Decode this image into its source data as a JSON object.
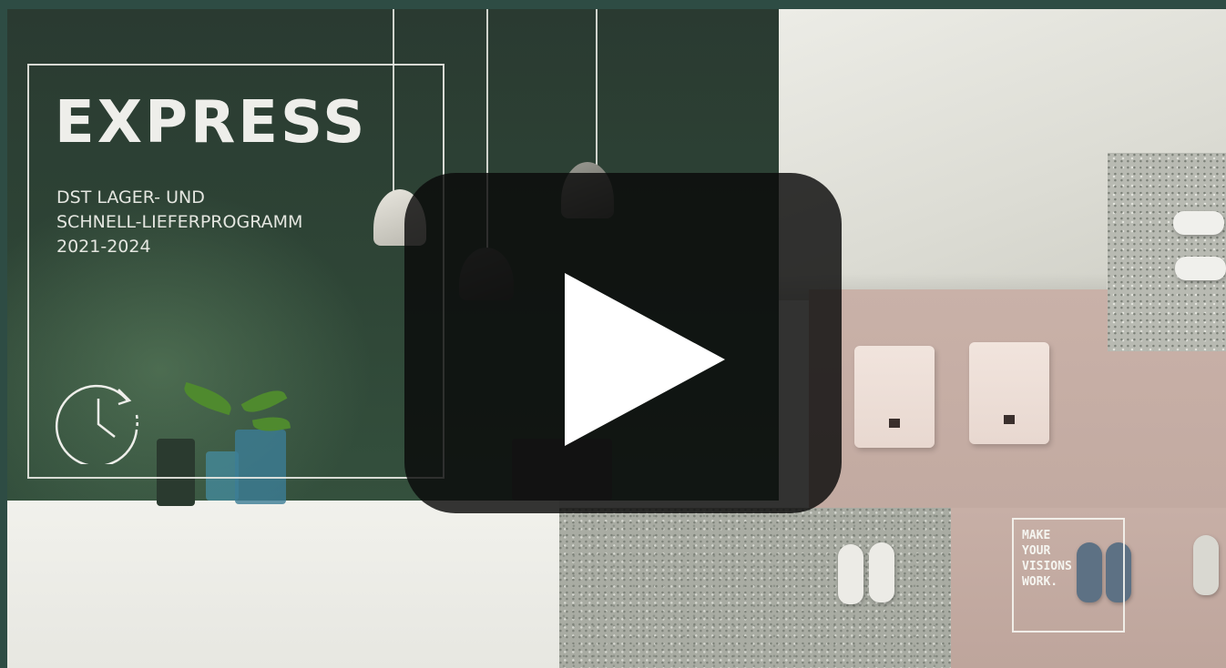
{
  "video": {
    "brochure": {
      "title": "EXPRESS",
      "subtitle_lines": [
        "DST LAGER- UND",
        "SCHNELL-LIEFERPROGRAMM",
        "2021-2024"
      ]
    },
    "slogan_lines": [
      "MAKE",
      "YOUR",
      "VISIONS",
      "WORK."
    ],
    "play_button": {
      "icon": "play-icon",
      "color": "#ffffff"
    },
    "colors": {
      "frame": "#2e4c44",
      "wall_green": "#2e4536",
      "pink": "#c9b1a8",
      "overlay": "#0a0a0a"
    }
  }
}
